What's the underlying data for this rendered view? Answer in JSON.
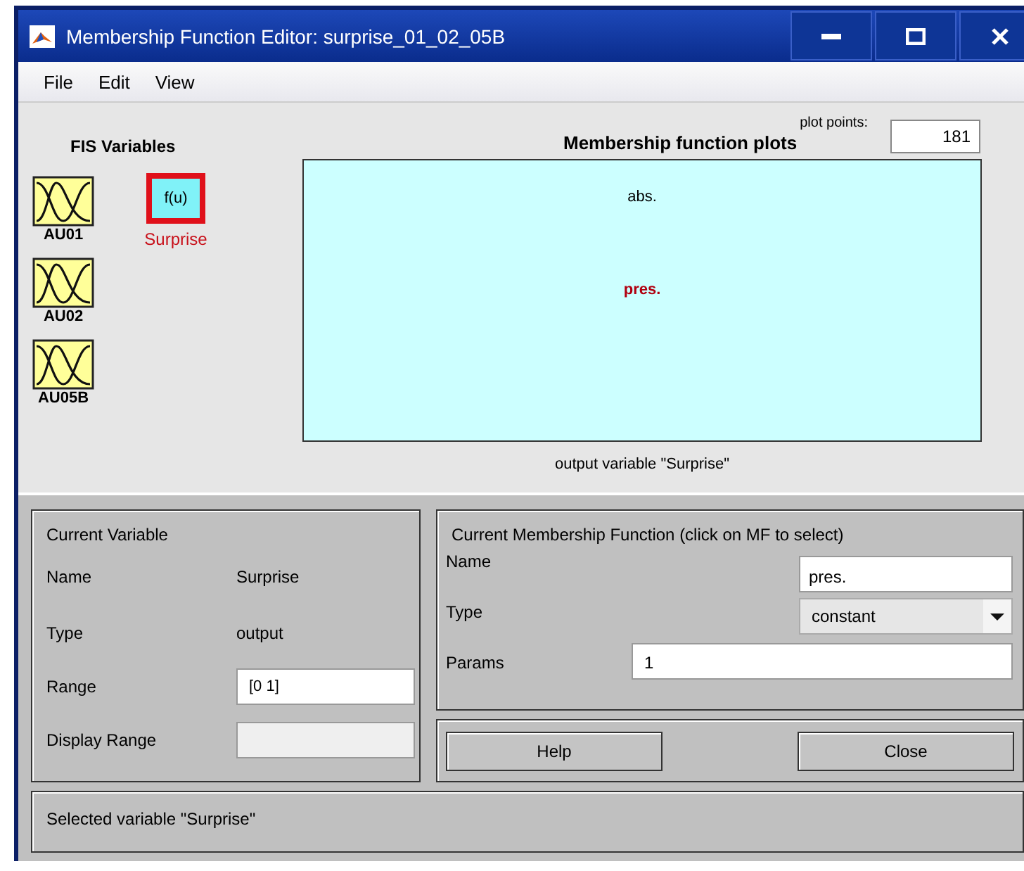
{
  "window": {
    "title": "Membership Function Editor: surprise_01_02_05B"
  },
  "menu": [
    "File",
    "Edit",
    "View"
  ],
  "fis_variables": {
    "title": "FIS Variables",
    "items": [
      {
        "name": "AU01",
        "kind": "input",
        "selected": false
      },
      {
        "name": "AU02",
        "kind": "input",
        "selected": false
      },
      {
        "name": "AU05B",
        "kind": "input",
        "selected": false
      },
      {
        "name": "Surprise",
        "kind": "output",
        "icon_text": "f(u)",
        "selected": true
      }
    ]
  },
  "plot": {
    "title": "Membership function plots",
    "plot_points_label": "plot points:",
    "plot_points": "181",
    "mfs": [
      {
        "name": "abs.",
        "selected": false
      },
      {
        "name": "pres.",
        "selected": true
      }
    ],
    "caption": "output variable \"Surprise\""
  },
  "current_variable": {
    "title": "Current Variable",
    "rows": [
      {
        "label": "Name",
        "kind": "text",
        "value": "Surprise"
      },
      {
        "label": "Type",
        "kind": "text",
        "value": "output"
      },
      {
        "label": "Range",
        "kind": "field",
        "value": "[0 1]",
        "disabled": false
      },
      {
        "label": "Display Range",
        "kind": "field",
        "disabled": true
      }
    ]
  },
  "current_mf": {
    "title": "Current Membership Function (click on MF to select)",
    "rows": [
      {
        "label": "Name",
        "kind": "field",
        "value": "pres."
      },
      {
        "label": "Type",
        "kind": "dropdown",
        "value": "constant"
      },
      {
        "label": "Params",
        "kind": "wide_field",
        "value": "1"
      }
    ]
  },
  "buttons": [
    "Help",
    "Close"
  ],
  "status": "Selected variable \"Surprise\""
}
